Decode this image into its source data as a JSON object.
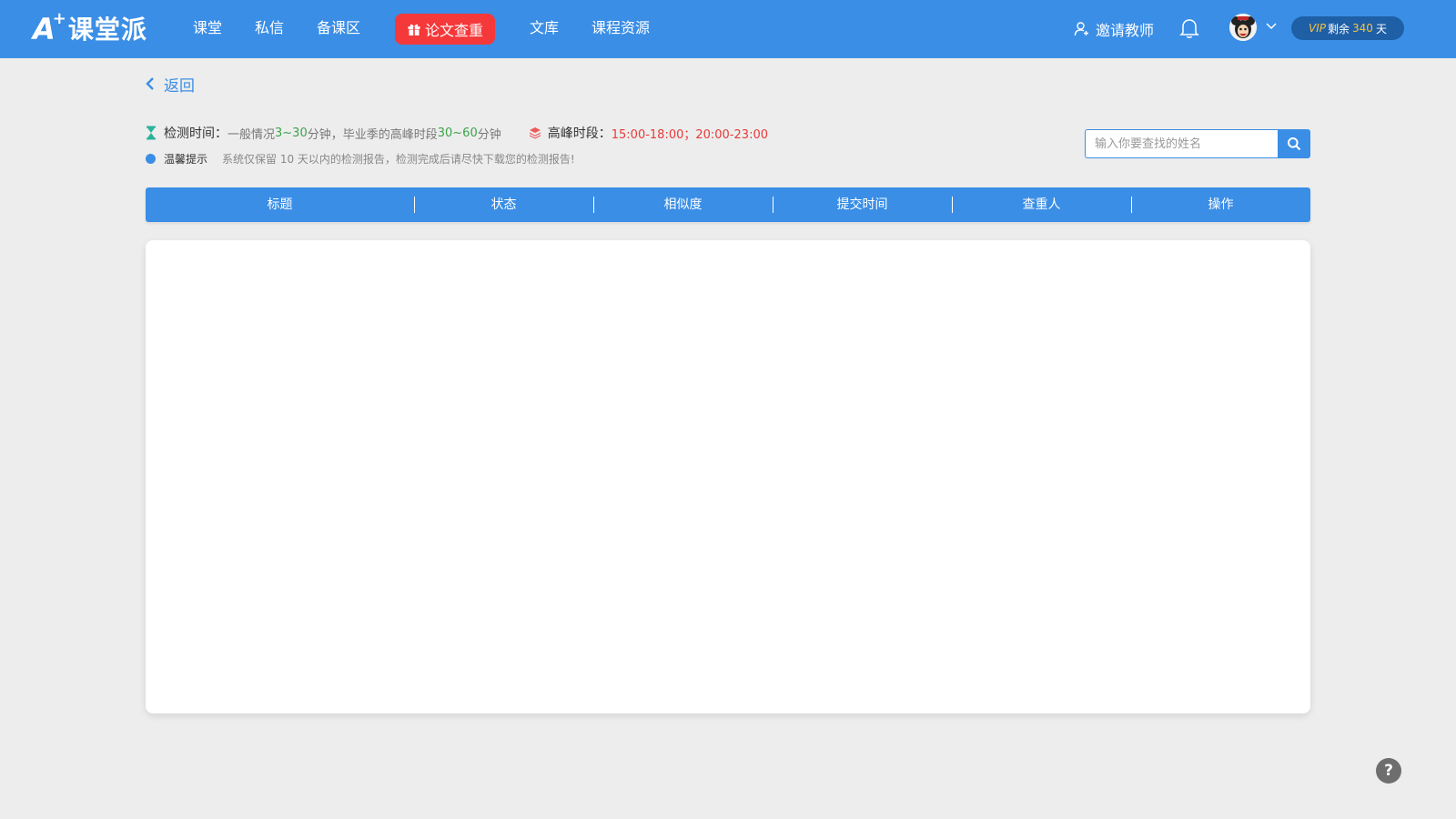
{
  "header": {
    "logo_a": "A",
    "logo_plus": "+",
    "logo_name": "课堂派",
    "nav": [
      {
        "label": "课堂"
      },
      {
        "label": "私信"
      },
      {
        "label": "备课区"
      },
      {
        "label": "论文查重",
        "highlight": true
      },
      {
        "label": "文库"
      },
      {
        "label": "课程资源"
      }
    ],
    "invite_label": "邀请教师",
    "vip": {
      "prefix": "VIP",
      "text1": "剩余",
      "days": "340",
      "text2": "天"
    },
    "colors": {
      "bar": "#3a8ee6",
      "hot": "#f5383a",
      "vip_bg": "#1e5fa6",
      "vip_accent": "#f6c343"
    }
  },
  "back_label": "返回",
  "info": {
    "detect_label": "检测时间：",
    "detect_text1": "一般情况",
    "detect_range1": "3~30",
    "detect_text2": "分钟，毕业季的高峰时段",
    "detect_range2": "30~60",
    "detect_text3": " 分钟",
    "peak_label": "高峰时段：",
    "peak_value": "15:00-18:00；20:00-23:00",
    "tip_label": "温馨提示",
    "tip_text": "系统仅保留 10 天以内的检测报告，检测完成后请尽快下载您的检测报告!"
  },
  "search": {
    "placeholder": "输入你要查找的姓名",
    "value": ""
  },
  "table": {
    "columns": [
      "标题",
      "状态",
      "相似度",
      "提交时间",
      "查重人",
      "操作"
    ],
    "rows": []
  },
  "help_label": "?",
  "icons": {
    "hourglass": "hourglass-icon",
    "layers": "layers-icon",
    "search": "search-icon",
    "bell": "bell-icon",
    "user_add": "user-add-icon",
    "gift": "gift-icon",
    "chevron_left": "chevron-left-icon",
    "chevron_down": "chevron-down-icon"
  }
}
